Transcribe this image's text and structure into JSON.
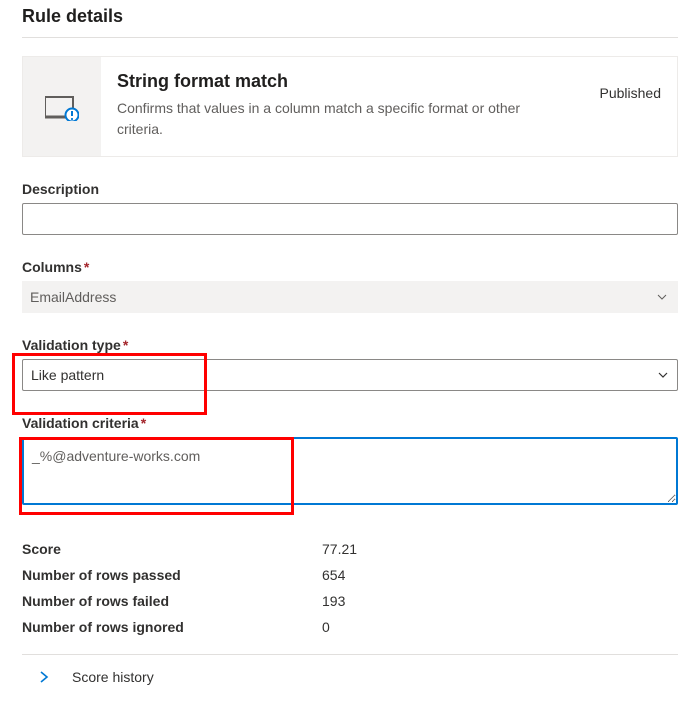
{
  "page_title": "Rule details",
  "card": {
    "title": "String format match",
    "description": "Confirms that values in a column match a specific format or other criteria.",
    "status": "Published"
  },
  "fields": {
    "description_label": "Description",
    "description_value": "",
    "columns_label": "Columns",
    "columns_value": "EmailAddress",
    "validation_type_label": "Validation type",
    "validation_type_value": "Like pattern",
    "validation_criteria_label": "Validation criteria",
    "validation_criteria_value": "_%@adventure-works.com"
  },
  "metrics": [
    {
      "label": "Score",
      "value": "77.21"
    },
    {
      "label": "Number of rows passed",
      "value": "654"
    },
    {
      "label": "Number of rows failed",
      "value": "193"
    },
    {
      "label": "Number of rows ignored",
      "value": "0"
    }
  ],
  "score_history_label": "Score history"
}
